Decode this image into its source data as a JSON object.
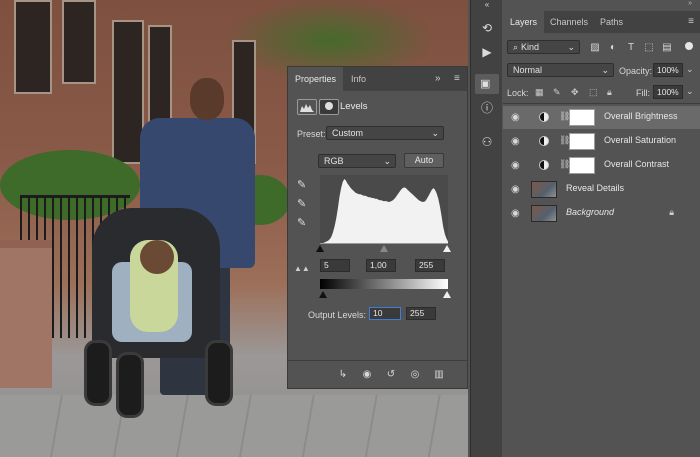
{
  "properties": {
    "tabs": [
      "Properties",
      "Info"
    ],
    "header_title": "Levels",
    "preset_label": "Preset:",
    "preset_value": "Custom",
    "channel_value": "RGB",
    "auto_label": "Auto",
    "input_black": "5",
    "input_gamma": "1,00",
    "input_white": "255",
    "output_label": "Output Levels:",
    "output_black": "10",
    "output_white": "255"
  },
  "layers_panel": {
    "tabs": [
      "Layers",
      "Channels",
      "Paths"
    ],
    "filter_value": "Kind",
    "blend_mode": "Normal",
    "opacity_label": "Opacity:",
    "opacity_value": "100%",
    "lock_label": "Lock:",
    "fill_label": "Fill:",
    "fill_value": "100%",
    "layers": [
      {
        "name": "Overall Brightness",
        "selected": true
      },
      {
        "name": "Overall Saturation"
      },
      {
        "name": "Overall Contrast"
      },
      {
        "name": "Reveal Details"
      },
      {
        "name": "Background",
        "locked": true
      }
    ]
  },
  "histogram": [
    0,
    0,
    0,
    1,
    2,
    3,
    5,
    8,
    14,
    22,
    32,
    45,
    60,
    72,
    80,
    84,
    82,
    78,
    75,
    72,
    70,
    68,
    66,
    65,
    64,
    64,
    63,
    62,
    62,
    61,
    60,
    60,
    59,
    59,
    58,
    58,
    57,
    56,
    56,
    55,
    55,
    55,
    54,
    54,
    55,
    56,
    58,
    61,
    64,
    67,
    70,
    72,
    73,
    72,
    70,
    68,
    66,
    64,
    62,
    60,
    58,
    56,
    55,
    54,
    54,
    55,
    58,
    62,
    66,
    70,
    72,
    70,
    65,
    58,
    48,
    36,
    22,
    12,
    6,
    2
  ],
  "colors": {
    "panel": "#535353",
    "selected_row": "#6a6a6a",
    "focus": "#3d7dd8"
  }
}
